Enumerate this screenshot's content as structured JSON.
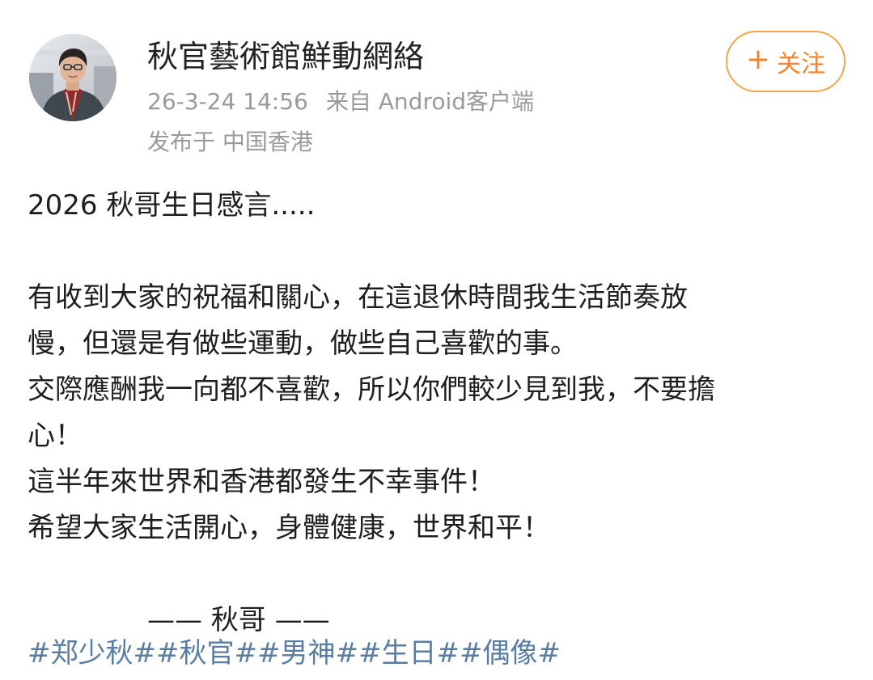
{
  "author": {
    "name": "秋官藝術館鮮動網絡",
    "timestamp": "26-3-24 14:56",
    "source": "来自 Android客户端",
    "location": "发布于 中国香港",
    "avatar_icon": "person-photo"
  },
  "follow": {
    "plus": "+",
    "label": "关注",
    "color": "#f2852d"
  },
  "post": {
    "lines": [
      "2026 秋哥生日感言.....",
      "",
      "有收到大家的祝福和關心，在這退休時間我生活節奏放",
      "慢，但還是有做些運動，做些自己喜歡的事。",
      "交際應酬我一向都不喜歡，所以你們較少見到我，不要擔",
      "心！",
      "這半年來世界和香港都發生不幸事件！",
      "希望大家生活開心，身體健康，世界和平！",
      "",
      "—— 秋哥 ——"
    ],
    "hashtags": [
      "#郑少秋#",
      "#秋官#",
      "#男神#",
      "#生日#",
      "#偶像#"
    ],
    "hashtag_color": "#5a7ea3"
  }
}
